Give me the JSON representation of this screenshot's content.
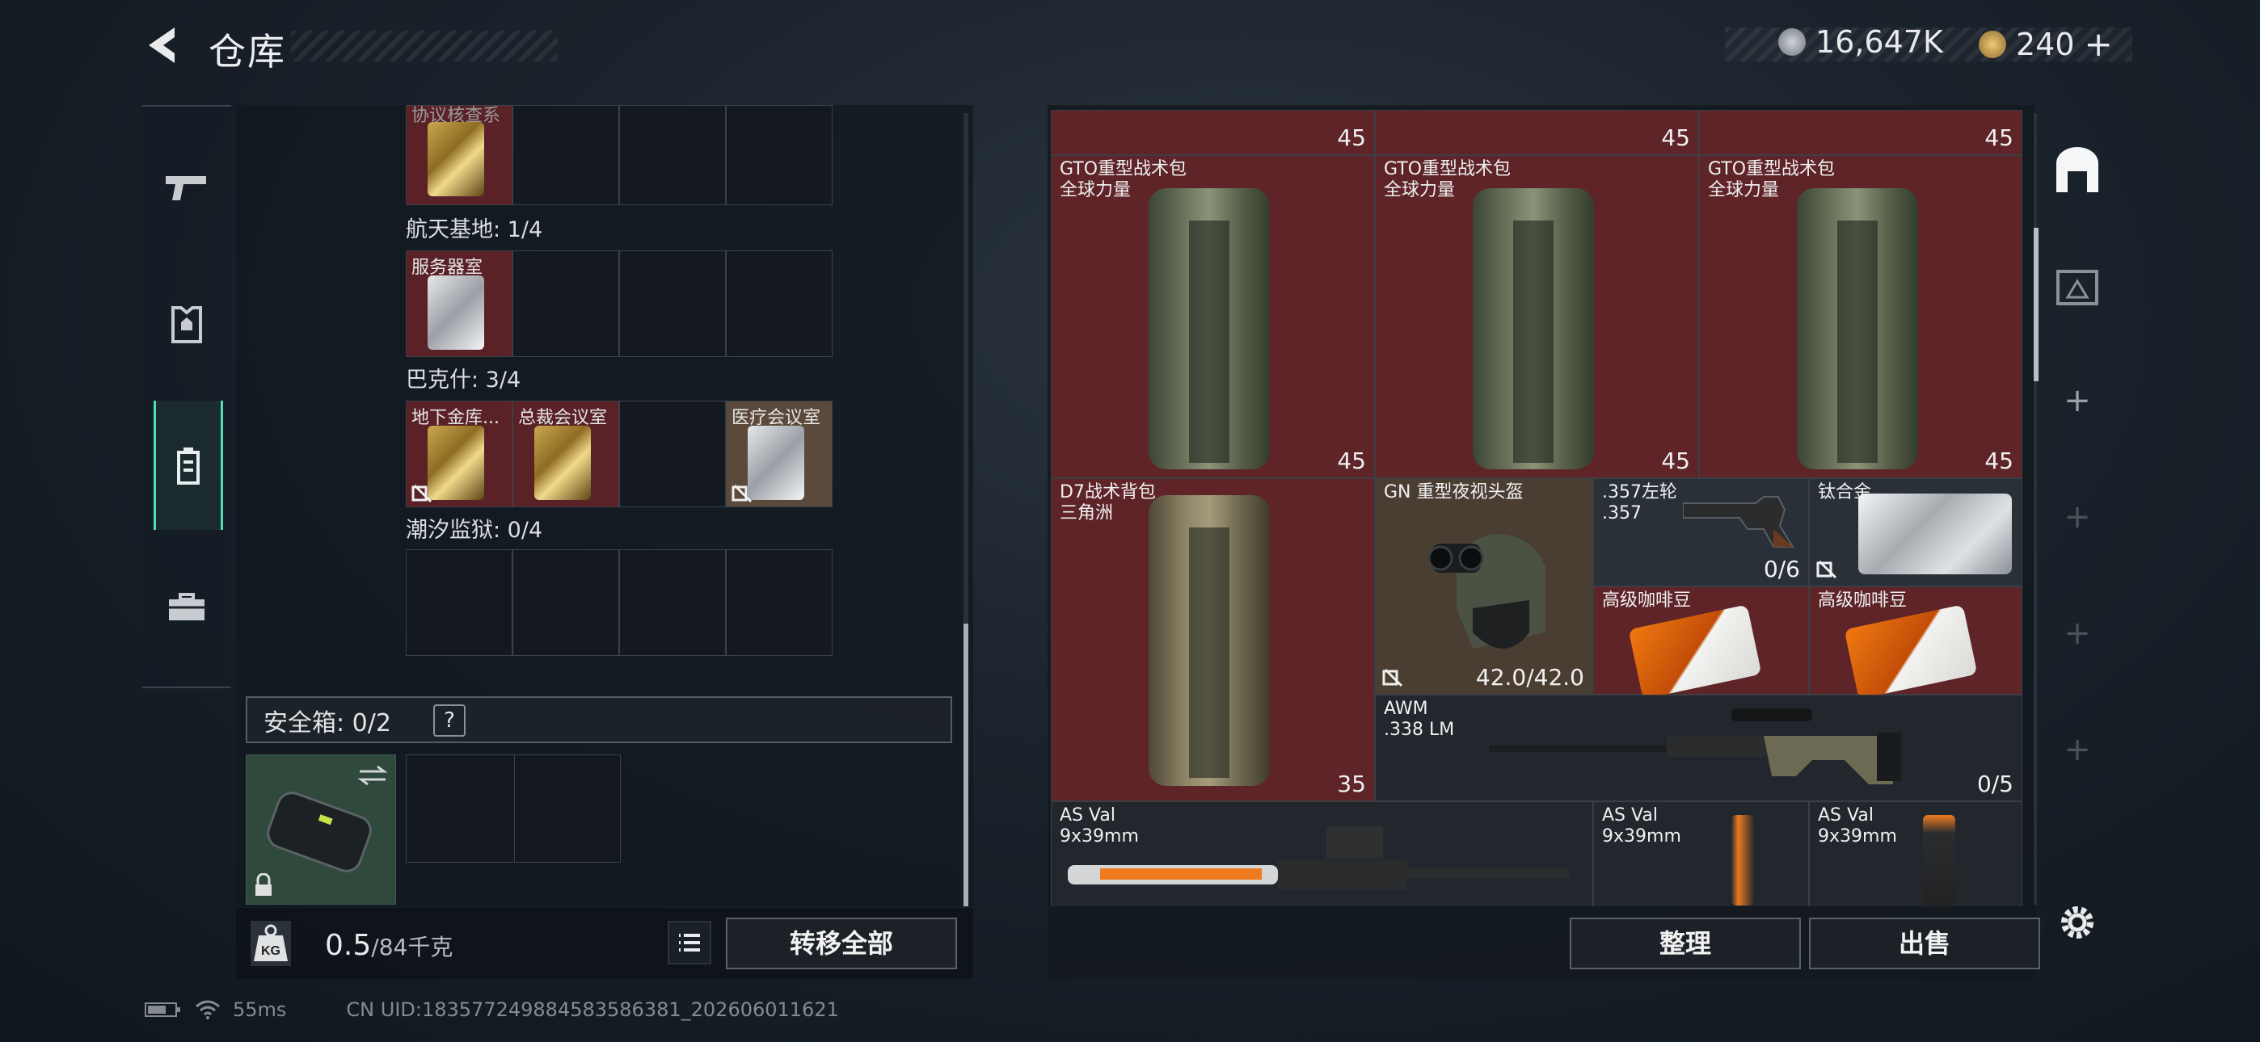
{
  "header": {
    "title": "仓库",
    "currency_silver": "16,647K",
    "currency_gold": "240",
    "currency_add": "+"
  },
  "left_nav": [
    {
      "name": "pistol-icon"
    },
    {
      "name": "armor-icon"
    },
    {
      "name": "backpack-icon"
    },
    {
      "name": "toolbox-icon"
    }
  ],
  "keycards": {
    "top_partial_label": "协议核查系",
    "sections": [
      {
        "title": "航天基地: 1/4",
        "cards": [
          {
            "label": "服务器室",
            "style": "white"
          }
        ]
      },
      {
        "title": "巴克什: 3/4",
        "cards": [
          {
            "label": "地下金库...",
            "style": "gold"
          },
          {
            "label": "总裁会议室",
            "style": "gold"
          },
          {
            "label": "",
            "style": "empty"
          },
          {
            "label": "医疗会议室",
            "style": "white"
          }
        ]
      },
      {
        "title": "潮汐监狱: 0/4",
        "cards": []
      }
    ]
  },
  "safe_box": {
    "label": "安全箱: 0/2",
    "help": "?"
  },
  "capacity": {
    "value": "0.5",
    "max": "/84千克"
  },
  "buttons": {
    "transfer_all": "转移全部",
    "organize": "整理",
    "sell": "出售"
  },
  "stash_items": {
    "top_row_counts": [
      "45",
      "45",
      "45"
    ],
    "backpacks": [
      {
        "name": "GTO重型战术包\n全球力量",
        "count": "45"
      },
      {
        "name": "GTO重型战术包\n全球力量",
        "count": "45"
      },
      {
        "name": "GTO重型战术包\n全球力量",
        "count": "45"
      }
    ],
    "d7": {
      "name": "D7战术背包\n三角洲",
      "count": "35"
    },
    "helmet": {
      "name": "GN 重型夜视头盔",
      "durability": "42.0/42.0"
    },
    "revolver": {
      "name": ".357左轮\n.357",
      "count": "0/6"
    },
    "titanium": {
      "name": "钛合金"
    },
    "coffee": [
      {
        "name": "高级咖啡豆"
      },
      {
        "name": "高级咖啡豆"
      }
    ],
    "awm": {
      "name": "AWM\n.338 LM",
      "count": "0/5"
    },
    "asval": [
      {
        "name": "AS Val\n9x39mm"
      },
      {
        "name": "AS Val\n9x39mm"
      },
      {
        "name": "AS Val\n9x39mm"
      }
    ]
  },
  "footer": {
    "ping": "55ms",
    "uid": "CN UID:18357724988458358638​1_202606011621"
  },
  "colors": {
    "accent": "#4de0b0",
    "item_red": "#5e2428"
  }
}
